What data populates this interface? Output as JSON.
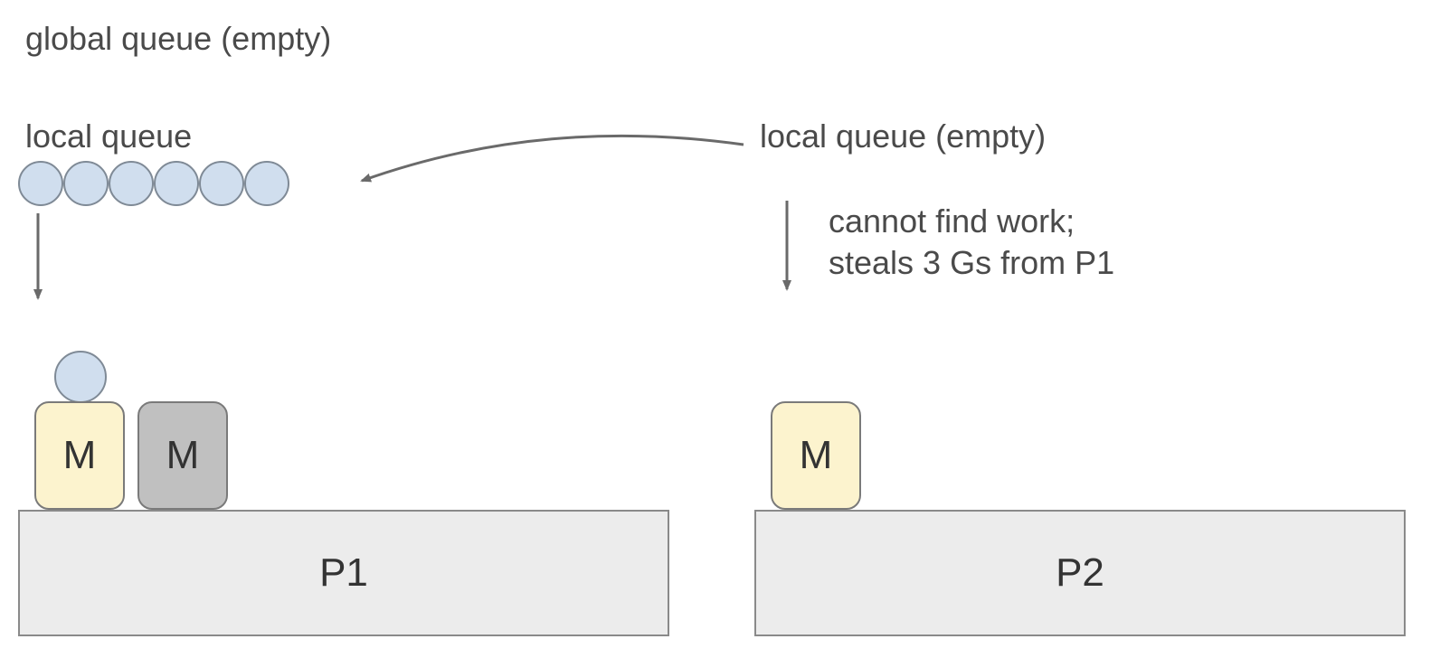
{
  "labels": {
    "global_queue": "global queue (empty)",
    "local_queue_1": "local queue",
    "local_queue_2": "local queue (empty)",
    "note_line1": "cannot find work;",
    "note_line2": "steals 3 Gs from P1"
  },
  "processors": {
    "p1": {
      "label": "P1"
    },
    "p2": {
      "label": "P2"
    }
  },
  "threads": {
    "m1": {
      "label": "M"
    },
    "m2": {
      "label": "M"
    },
    "m3": {
      "label": "M"
    }
  },
  "colors": {
    "goroutine_fill": "#d0deee",
    "goroutine_stroke": "#7f8a96",
    "m_active_fill": "#fcf3ce",
    "m_idle_fill": "#c0c0c0",
    "p_fill": "#ececec",
    "arrow": "#6a6a6a"
  },
  "queue_counts": {
    "p1_local_queue": 6,
    "p2_local_queue": 0,
    "global_queue": 0
  }
}
